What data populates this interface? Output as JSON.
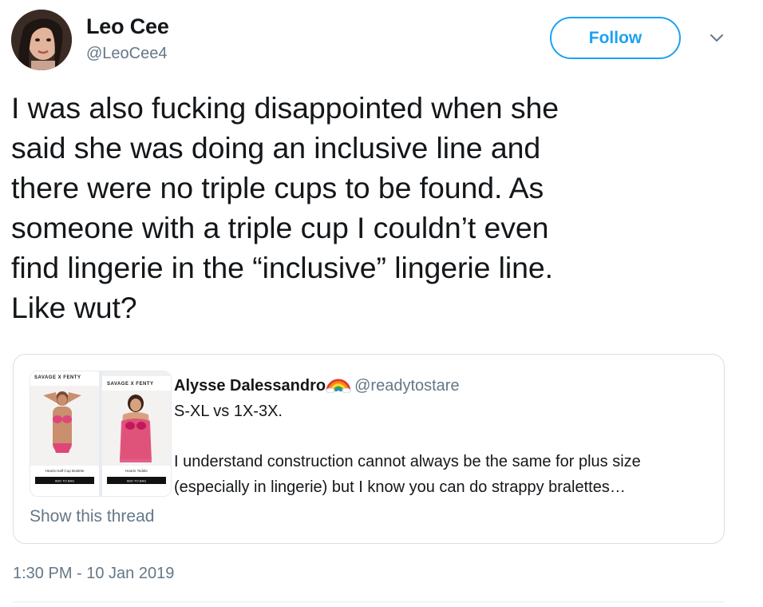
{
  "author": {
    "display_name": "Leo Cee",
    "handle": "@LeoCee4",
    "avatar_icon": "user-avatar-photo"
  },
  "follow_label": "Follow",
  "more_icon": "chevron-down-icon",
  "tweet_lines": [
    "I was also fucking disappointed when she",
    "said she was doing an inclusive line and",
    "there were no triple cups to be found. As",
    "someone with a triple cup I couldn’t even",
    "find lingerie in the “inclusive” lingerie line.",
    "Like wut?"
  ],
  "quote": {
    "display_name": "Alysse Dalessandro",
    "emoji": "rainbow-emoji",
    "handle": "@readytostare",
    "line1": "S-XL vs 1X-3X.",
    "line2": "I understand construction cannot always be the same for plus size",
    "line3": "(especially in lingerie) but I know you can do strappy bralettes…",
    "show_thread": "Show this thread",
    "media": {
      "brand_left": "SAVAGE X FENTY",
      "brand_right": "SAVAGE X FENTY",
      "product_left": "Hearts Half Cup Bralette",
      "product_right": "Hearts Teddie",
      "cta": "ADD TO BAG"
    }
  },
  "timestamp": "1:30 PM - 10 Jan 2019",
  "colors": {
    "accent": "#1da1f2",
    "secondary_text": "#657786",
    "border": "#d8dfe4"
  }
}
